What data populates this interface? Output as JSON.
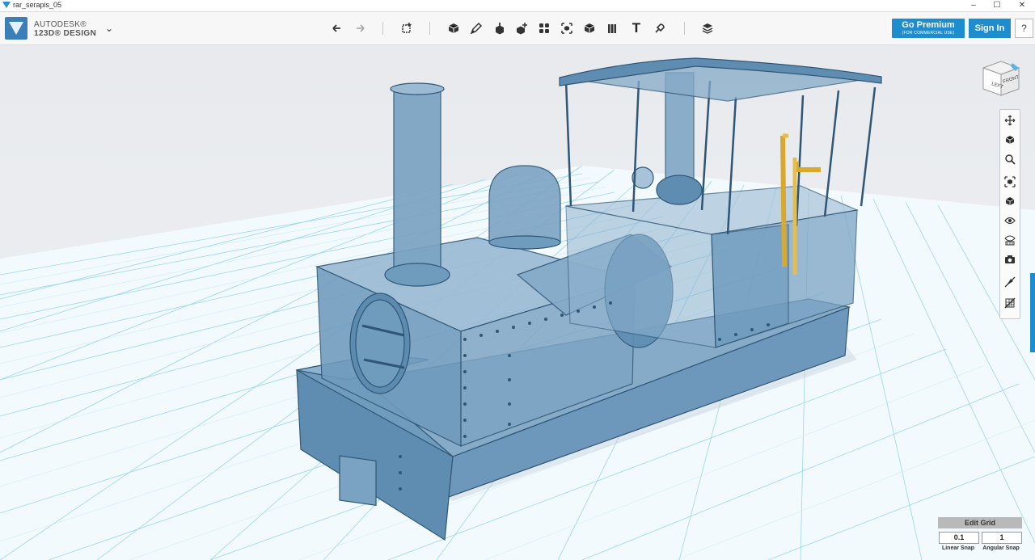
{
  "window": {
    "title": "rar_serapis_05",
    "minimize": "–",
    "maximize": "☐",
    "close": "✕"
  },
  "app": {
    "brand_line1": "AUTODESK®",
    "brand_line2": "123D® DESIGN",
    "menu_chevron": "⌄"
  },
  "toolbar": {
    "tools": [
      {
        "id": "undo",
        "icon": "undo-icon"
      },
      {
        "id": "redo",
        "icon": "redo-icon"
      },
      {
        "id": "transform",
        "icon": "transform-icon"
      },
      {
        "id": "primitives",
        "icon": "primitives-icon"
      },
      {
        "id": "sketch",
        "icon": "sketch-icon"
      },
      {
        "id": "construct",
        "icon": "construct-icon"
      },
      {
        "id": "modify",
        "icon": "modify-icon"
      },
      {
        "id": "pattern",
        "icon": "pattern-icon"
      },
      {
        "id": "group",
        "icon": "group-icon"
      },
      {
        "id": "combine",
        "icon": "combine-icon"
      },
      {
        "id": "measure",
        "icon": "measure-icon"
      },
      {
        "id": "text",
        "icon": "text-icon"
      },
      {
        "id": "snap",
        "icon": "snap-icon"
      },
      {
        "id": "material",
        "icon": "material-icon"
      }
    ],
    "text_tool_glyph": "T",
    "go_premium": "Go Premium",
    "go_premium_sub": "(FOR COMMERCIAL USE)",
    "sign_in": "Sign In",
    "help": "?"
  },
  "viewcube": {
    "left_face": "LEFT",
    "front_face": "FRONT"
  },
  "nav_bar": {
    "items": [
      "pan-icon",
      "orbit-icon",
      "zoom-icon",
      "fit-icon",
      "ortho-icon",
      "visibility-icon",
      "materials-icon",
      "screenshot-icon",
      "hide-sketch-icon",
      "hide-mesh-icon"
    ]
  },
  "grid": {
    "edit_label": "Edit Grid",
    "linear_snap": "0.1",
    "linear_label": "Linear Snap",
    "angular_snap": "1",
    "angular_label": "Angular Snap"
  },
  "colors": {
    "accent": "#1d8dd0",
    "model_fill": "#6e99bb",
    "model_stroke": "#2f5676",
    "grid_line": "#8fd0ee",
    "brass": "#d9a82e"
  }
}
